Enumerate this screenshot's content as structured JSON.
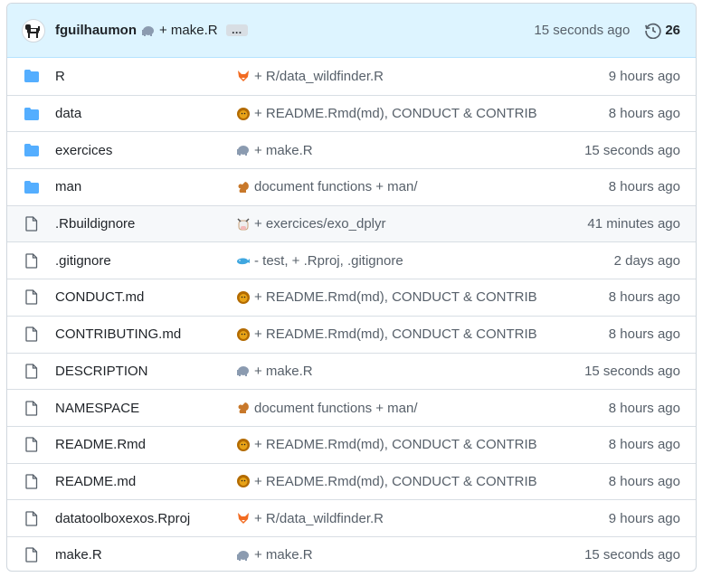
{
  "header": {
    "author": "fguilhaumon",
    "message": "+ make.R",
    "ellipsis": "…",
    "time": "15 seconds ago",
    "commit_count": "26"
  },
  "rows": [
    {
      "type": "dir",
      "name": "R",
      "emoji": "fox",
      "message": "+ R/data_wildfinder.R",
      "time": "9 hours ago"
    },
    {
      "type": "dir",
      "name": "data",
      "emoji": "lion",
      "message": "+ README.Rmd(md), CONDUCT & CONTRIB",
      "time": "8 hours ago"
    },
    {
      "type": "dir",
      "name": "exercices",
      "emoji": "elephant",
      "message": "+ make.R",
      "time": "15 seconds ago"
    },
    {
      "type": "dir",
      "name": "man",
      "emoji": "squirrel",
      "message": "document functions + man/",
      "time": "8 hours ago"
    },
    {
      "type": "file",
      "name": ".Rbuildignore",
      "emoji": "cow",
      "message": "+ exercices/exo_dplyr",
      "time": "41 minutes ago"
    },
    {
      "type": "file",
      "name": ".gitignore",
      "emoji": "whale",
      "message": "- test, + .Rproj, .gitignore",
      "time": "2 days ago"
    },
    {
      "type": "file",
      "name": "CONDUCT.md",
      "emoji": "lion",
      "message": "+ README.Rmd(md), CONDUCT & CONTRIB",
      "time": "8 hours ago"
    },
    {
      "type": "file",
      "name": "CONTRIBUTING.md",
      "emoji": "lion",
      "message": "+ README.Rmd(md), CONDUCT & CONTRIB",
      "time": "8 hours ago"
    },
    {
      "type": "file",
      "name": "DESCRIPTION",
      "emoji": "elephant",
      "message": "+ make.R",
      "time": "15 seconds ago"
    },
    {
      "type": "file",
      "name": "NAMESPACE",
      "emoji": "squirrel",
      "message": "document functions + man/",
      "time": "8 hours ago"
    },
    {
      "type": "file",
      "name": "README.Rmd",
      "emoji": "lion",
      "message": "+ README.Rmd(md), CONDUCT & CONTRIB",
      "time": "8 hours ago"
    },
    {
      "type": "file",
      "name": "README.md",
      "emoji": "lion",
      "message": "+ README.Rmd(md), CONDUCT & CONTRIB",
      "time": "8 hours ago"
    },
    {
      "type": "file",
      "name": "datatoolboxexos.Rproj",
      "emoji": "fox",
      "message": "+ R/data_wildfinder.R",
      "time": "9 hours ago"
    },
    {
      "type": "file",
      "name": "make.R",
      "emoji": "elephant",
      "message": "+ make.R",
      "time": "15 seconds ago"
    }
  ],
  "colors": {
    "folder": "#54aeff",
    "file_icon": "#57606a",
    "header_bg": "#ddf4ff",
    "fox": "#f26b21",
    "lion": "#e8a317",
    "elephant": "#8b9bb0",
    "squirrel": "#c8782a",
    "cow": "#c9a27a",
    "whale": "#3fa7e0"
  }
}
